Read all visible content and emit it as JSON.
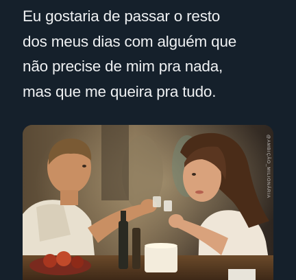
{
  "post": {
    "text_lines": [
      "Eu gostaria de passar o resto",
      "dos meus dias com alguém que",
      "não precise de mim pra nada,",
      "mas que me queira pra tudo."
    ]
  },
  "media": {
    "description_icon": "photo-image",
    "watermark": "@AMBIÇÃO_MILIONÁRIA"
  },
  "colors": {
    "background": "#15202b",
    "text": "#eef0f2"
  }
}
